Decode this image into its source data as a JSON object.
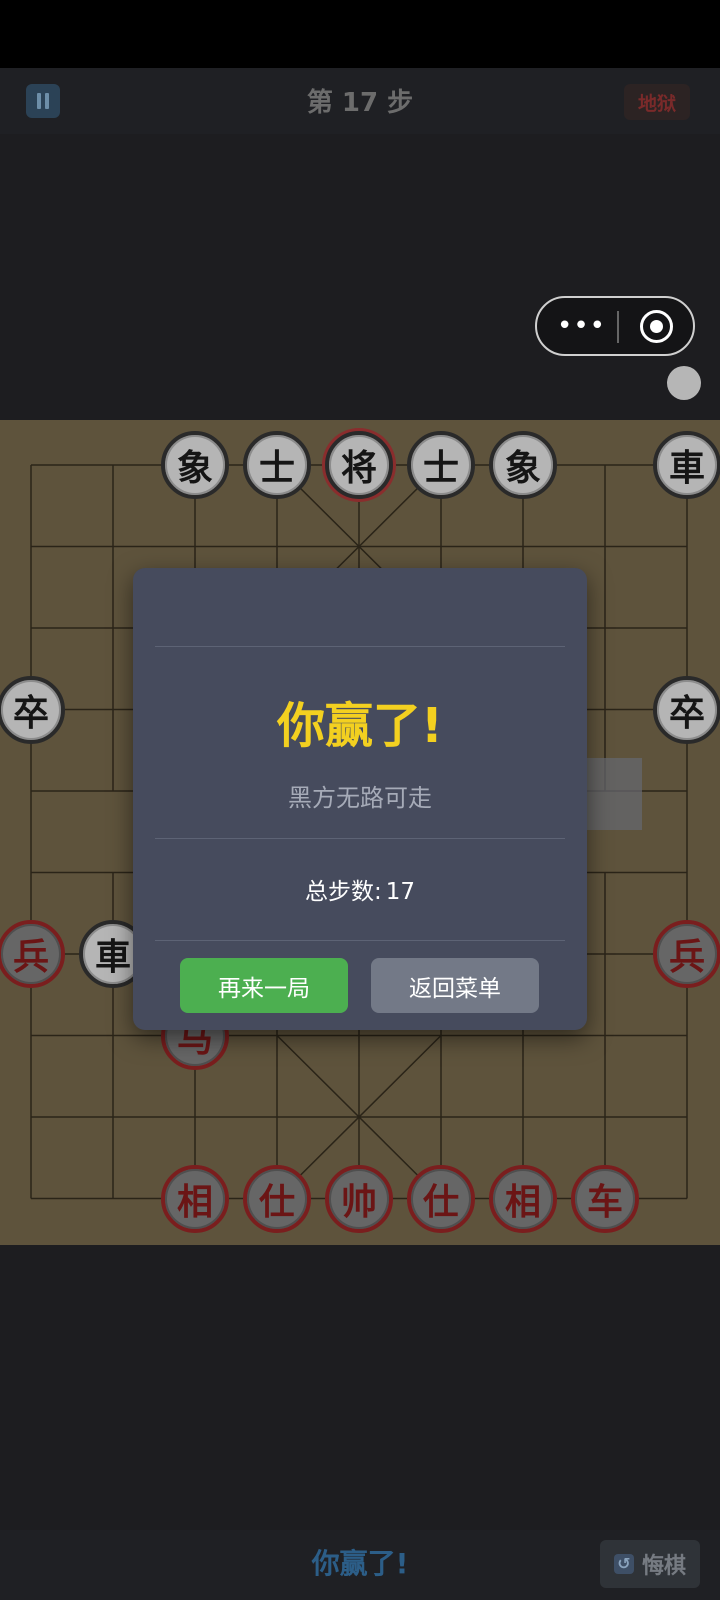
{
  "header": {
    "step_prefix": "第",
    "step_number": "17",
    "step_suffix": "步",
    "difficulty": "地狱"
  },
  "miniprogram": {
    "more_icon": "•••"
  },
  "board": {
    "colors": {
      "wood": "#5e533c",
      "line": "#2a2418",
      "black_piece": "#b5b5b5",
      "red_piece": "#666666"
    },
    "pieces": [
      {
        "label": "象",
        "side": "black",
        "col": 2,
        "row": 0
      },
      {
        "label": "士",
        "side": "black",
        "col": 3,
        "row": 0
      },
      {
        "label": "将",
        "side": "black",
        "col": 4,
        "row": 0,
        "selected": true
      },
      {
        "label": "士",
        "side": "black",
        "col": 5,
        "row": 0
      },
      {
        "label": "象",
        "side": "black",
        "col": 6,
        "row": 0
      },
      {
        "label": "車",
        "side": "black",
        "col": 8,
        "row": 0
      },
      {
        "label": "卒",
        "side": "black",
        "col": 0,
        "row": 3
      },
      {
        "label": "卒",
        "side": "black",
        "col": 8,
        "row": 3
      },
      {
        "label": "兵",
        "side": "red",
        "col": 0,
        "row": 6
      },
      {
        "label": "車",
        "side": "black",
        "col": 1,
        "row": 6
      },
      {
        "label": "兵",
        "side": "red",
        "col": 8,
        "row": 6
      },
      {
        "label": "马",
        "side": "red",
        "col": 2,
        "row": 7
      },
      {
        "label": "相",
        "side": "red",
        "col": 2,
        "row": 9
      },
      {
        "label": "仕",
        "side": "red",
        "col": 3,
        "row": 9
      },
      {
        "label": "帅",
        "side": "red",
        "col": 4,
        "row": 9
      },
      {
        "label": "仕",
        "side": "red",
        "col": 5,
        "row": 9
      },
      {
        "label": "相",
        "side": "red",
        "col": 6,
        "row": 9
      },
      {
        "label": "车",
        "side": "red",
        "col": 7,
        "row": 9
      }
    ]
  },
  "dialog": {
    "title": "你赢了!",
    "reason": "黑方无路可走",
    "total_label": "总步数:",
    "total_value": "17",
    "again_button": "再来一局",
    "menu_button": "返回菜单"
  },
  "footer": {
    "status": "你赢了!",
    "undo_icon": "↺",
    "undo_label": "悔棋"
  }
}
